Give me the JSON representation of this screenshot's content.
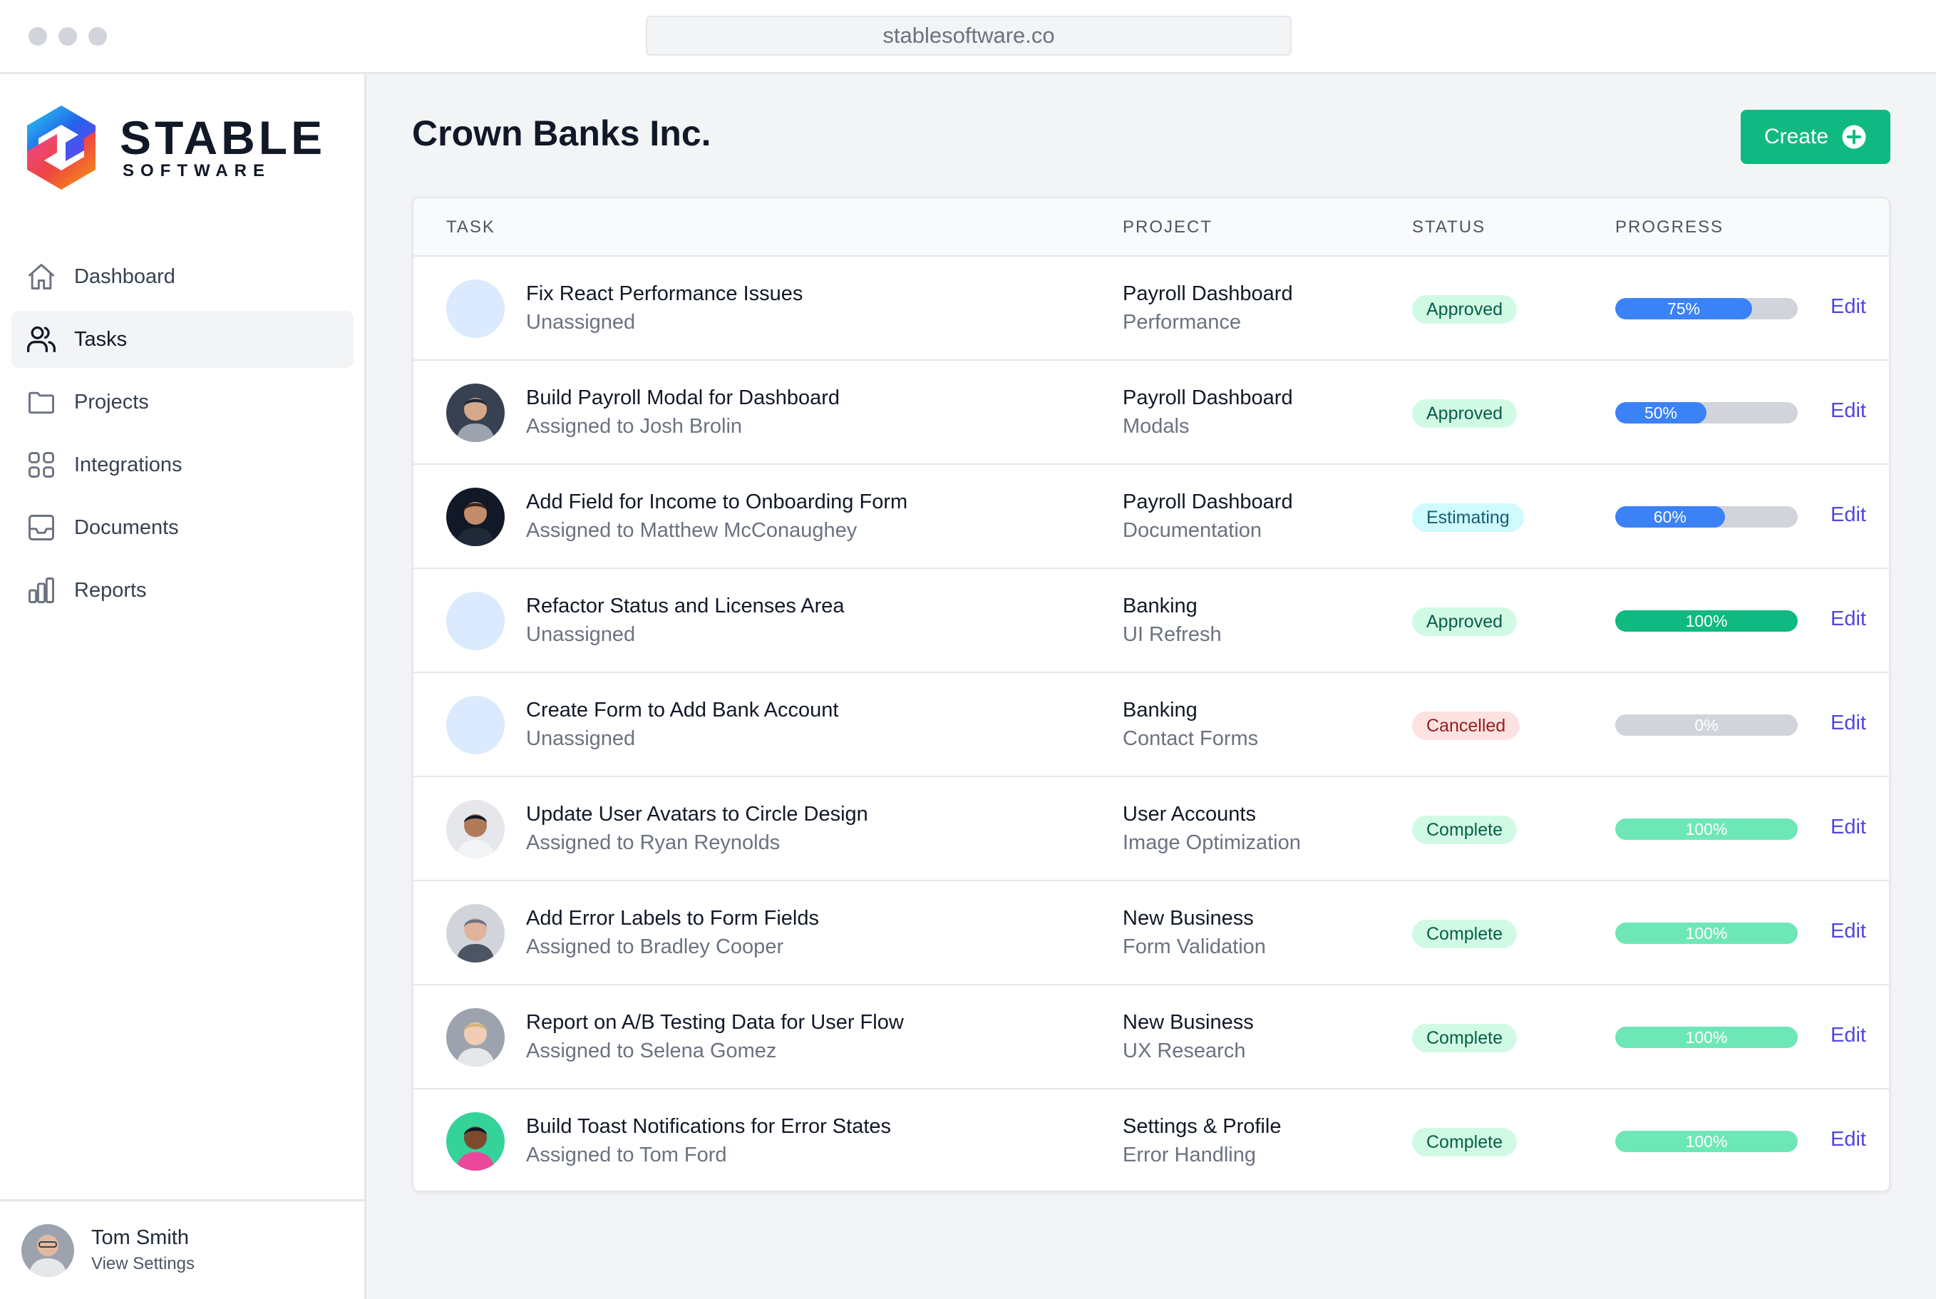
{
  "browser": {
    "url": "stablesoftware.co"
  },
  "logo": {
    "main": "STABLE",
    "sub": "SOFTWARE"
  },
  "sidebar": {
    "items": [
      {
        "label": "Dashboard",
        "icon": "home-icon",
        "active": false
      },
      {
        "label": "Tasks",
        "icon": "users-icon",
        "active": true
      },
      {
        "label": "Projects",
        "icon": "folder-icon",
        "active": false
      },
      {
        "label": "Integrations",
        "icon": "grid-icon",
        "active": false
      },
      {
        "label": "Documents",
        "icon": "inbox-icon",
        "active": false
      },
      {
        "label": "Reports",
        "icon": "chart-bar-icon",
        "active": false
      }
    ],
    "user": {
      "name": "Tom Smith",
      "link": "View Settings"
    }
  },
  "main": {
    "title": "Crown Banks Inc.",
    "create_label": "Create",
    "columns": {
      "task": "TASK",
      "project": "PROJECT",
      "status": "STATUS",
      "progress": "PROGRESS"
    },
    "edit_label": "Edit",
    "rows": [
      {
        "task": "Fix React Performance Issues",
        "assignee": "Unassigned",
        "project": "Payroll Dashboard",
        "subproject": "Performance",
        "status": "Approved",
        "progress": 75,
        "progress_label": "75%",
        "bar_color": "#3b82f6",
        "avatar": "none"
      },
      {
        "task": "Build Payroll Modal for Dashboard",
        "assignee": "Assigned to Josh Brolin",
        "project": "Payroll Dashboard",
        "subproject": "Modals",
        "status": "Approved",
        "progress": 50,
        "progress_label": "50%",
        "bar_color": "#3b82f6",
        "avatar": "photo"
      },
      {
        "task": "Add Field for Income to Onboarding Form",
        "assignee": "Assigned to Matthew McConaughey",
        "project": "Payroll Dashboard",
        "subproject": "Documentation",
        "status": "Estimating",
        "progress": 60,
        "progress_label": "60%",
        "bar_color": "#3b82f6",
        "avatar": "photo"
      },
      {
        "task": "Refactor Status and Licenses Area",
        "assignee": "Unassigned",
        "project": "Banking",
        "subproject": "UI Refresh",
        "status": "Approved",
        "progress": 100,
        "progress_label": "100%",
        "bar_color": "#10b981",
        "avatar": "none"
      },
      {
        "task": "Create Form to Add Bank Account",
        "assignee": "Unassigned",
        "project": "Banking",
        "subproject": "Contact Forms",
        "status": "Cancelled",
        "progress": 0,
        "progress_label": "0%",
        "bar_color": "#d1d5db",
        "avatar": "none"
      },
      {
        "task": "Update User Avatars to Circle Design",
        "assignee": "Assigned to Ryan Reynolds",
        "project": "User Accounts",
        "subproject": "Image Optimization",
        "status": "Complete",
        "progress": 100,
        "progress_label": "100%",
        "bar_color": "#6ee7b7",
        "avatar": "photo"
      },
      {
        "task": "Add Error Labels to Form Fields",
        "assignee": "Assigned to Bradley Cooper",
        "project": "New Business",
        "subproject": "Form Validation",
        "status": "Complete",
        "progress": 100,
        "progress_label": "100%",
        "bar_color": "#6ee7b7",
        "avatar": "photo"
      },
      {
        "task": "Report on A/B Testing Data for User Flow",
        "assignee": "Assigned to Selena Gomez",
        "project": "New Business",
        "subproject": "UX Research",
        "status": "Complete",
        "progress": 100,
        "progress_label": "100%",
        "bar_color": "#6ee7b7",
        "avatar": "photo"
      },
      {
        "task": "Build Toast Notifications for Error States",
        "assignee": "Assigned to Tom Ford",
        "project": "Settings & Profile",
        "subproject": "Error Handling",
        "status": "Complete",
        "progress": 100,
        "progress_label": "100%",
        "bar_color": "#6ee7b7",
        "avatar": "photo"
      }
    ]
  }
}
